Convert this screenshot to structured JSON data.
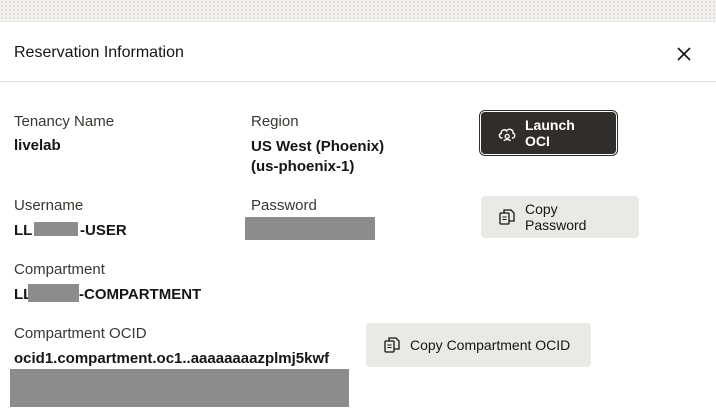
{
  "dialog": {
    "title": "Reservation Information"
  },
  "fields": {
    "tenancy": {
      "label": "Tenancy Name",
      "value": "livelab"
    },
    "region": {
      "label": "Region",
      "value_line1": "US West (Phoenix)",
      "value_line2": "(us-phoenix-1)"
    },
    "username": {
      "label": "Username",
      "prefix": "LL",
      "suffix": "-USER"
    },
    "password": {
      "label": "Password"
    },
    "compartment": {
      "label": "Compartment",
      "prefix": "LL",
      "suffix": "-COMPARTMENT"
    },
    "compartment_ocid": {
      "label": "Compartment OCID",
      "value": "ocid1.compartment.oc1..aaaaaaaazplmj5kwf"
    }
  },
  "buttons": {
    "launch": "Launch OCI",
    "copy_password": "Copy Password",
    "copy_ocid": "Copy Compartment OCID"
  },
  "icons": {
    "close": "close-icon",
    "launch": "cloud-launch-icon",
    "copy": "copy-icon"
  },
  "colors": {
    "primary_button": "#312d2a",
    "secondary_button": "#ebe9e6",
    "redaction": "#8c8c8c"
  }
}
